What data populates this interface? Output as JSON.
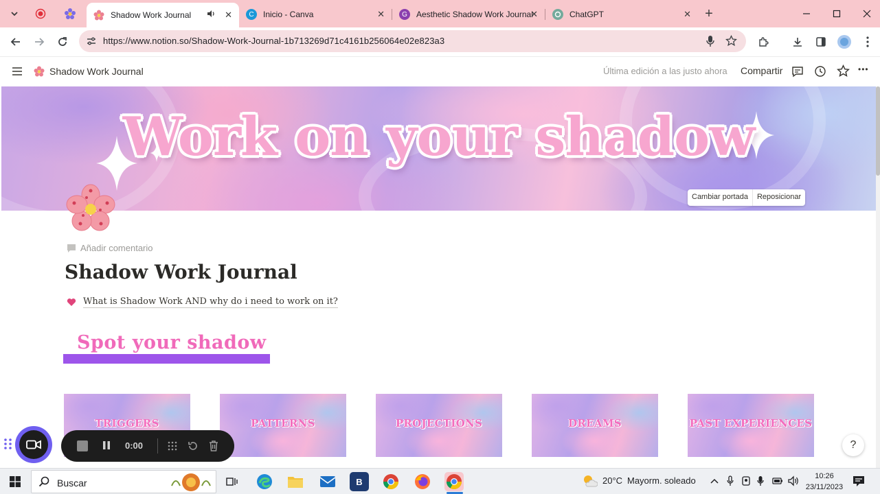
{
  "browser": {
    "tabs": [
      {
        "title": "Shadow Work Journal",
        "active": true
      },
      {
        "title": "Inicio - Canva",
        "active": false
      },
      {
        "title": "Aesthetic Shadow Work Journal",
        "active": false
      },
      {
        "title": "ChatGPT",
        "active": false
      }
    ],
    "close_glyph": "✕",
    "new_tab_glyph": "+",
    "url": "https://www.notion.so/Shadow-Work-Journal-1b713269d71c4161b256064e02e823a3"
  },
  "notion": {
    "breadcrumb_title": "Shadow Work Journal",
    "last_edited": "Última edición a las justo ahora",
    "share_label": "Compartir",
    "more_glyph": "•••"
  },
  "cover": {
    "title": "Work on your shadow",
    "change_cover_label": "Cambiar portada",
    "reposition_label": "Reposicionar"
  },
  "page": {
    "add_comment_label": "Añadir comentario",
    "title": "Shadow Work Journal",
    "callout_text": "What is Shadow Work AND why do i need to work on it?",
    "section_heading": "Spot your shadow",
    "cards": [
      {
        "label": "TRIGGERS"
      },
      {
        "label": "PATTERNS"
      },
      {
        "label": "PROJECTIONS"
      },
      {
        "label": "DREAMS"
      },
      {
        "label": "PAST EXPERIENCES"
      }
    ],
    "help_label": "?"
  },
  "recorder": {
    "timer": "0:00"
  },
  "taskbar": {
    "search_label": "Buscar",
    "weather_temp": "20°C",
    "weather_desc": "Mayorm. soleado",
    "time": "10:26",
    "date": "23/11/2023"
  },
  "colors": {
    "tabbar_bg": "#f8c8cd",
    "omnibox_bg": "#f6dfe2",
    "section_underline": "#9d55ea",
    "section_text": "#f06aba",
    "recorder_accent": "#6f5ff0"
  }
}
